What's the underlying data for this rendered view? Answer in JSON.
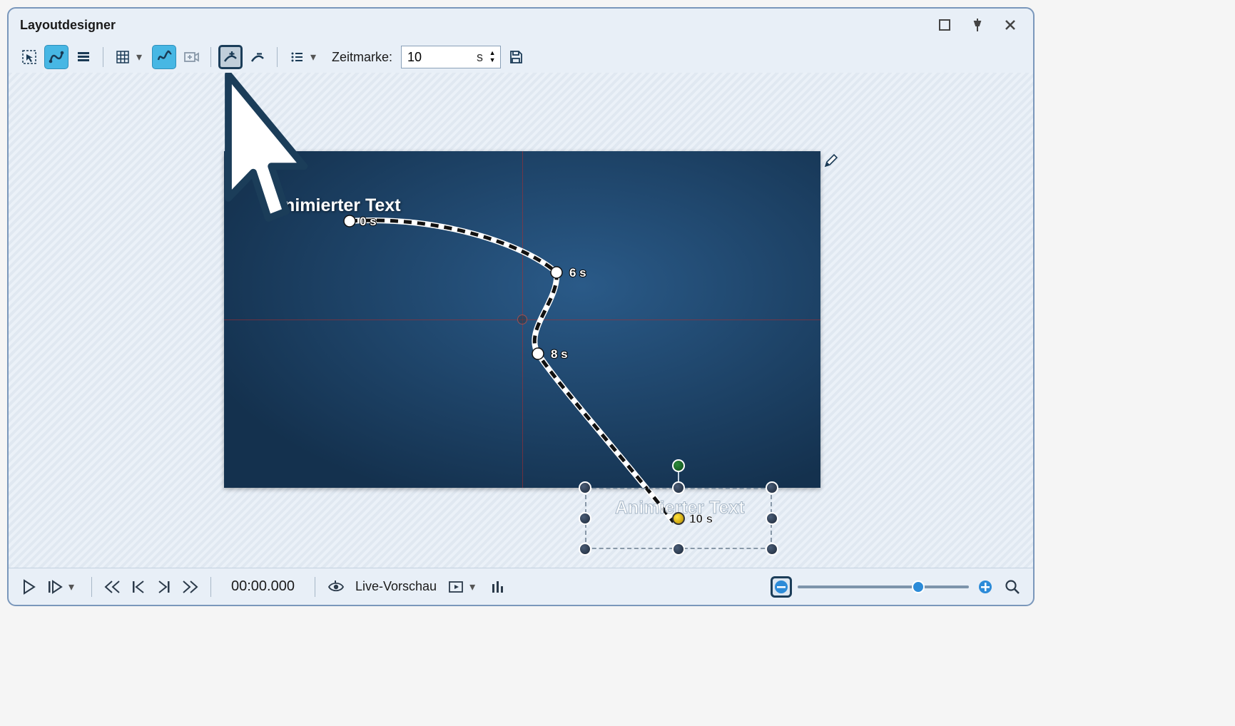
{
  "window": {
    "title": "Layoutdesigner"
  },
  "toolbar": {
    "time_label": "Zeitmarke:",
    "time_value": "10",
    "time_unit": "s"
  },
  "canvas": {
    "text1": "Animierter Text",
    "text2": "Animierter Text",
    "nodes": {
      "n0": "0 s",
      "n6": "6 s",
      "n8": "8 s",
      "n10": "10 s"
    }
  },
  "footer": {
    "timecode": "00:00.000",
    "live_preview": "Live-Vorschau"
  },
  "colors": {
    "accent": "#47b7e4",
    "frame": "#1b3d59"
  }
}
